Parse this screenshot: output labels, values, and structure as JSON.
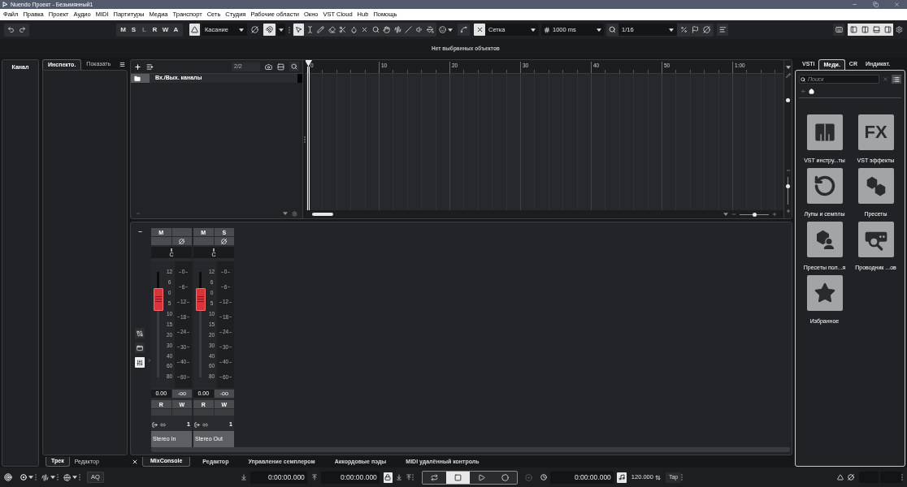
{
  "window": {
    "title": "Nuendo Проект - Безымянный1"
  },
  "menu": [
    "Файл",
    "Правка",
    "Проект",
    "Аудио",
    "MIDI",
    "Партитуры",
    "Медиа",
    "Транспорт",
    "Сеть",
    "Студия",
    "Рабочие области",
    "Окно",
    "VST Cloud",
    "Hub",
    "Помощь"
  ],
  "toolbar": {
    "modes": [
      {
        "label": "M",
        "disabled": false
      },
      {
        "label": "S",
        "disabled": false
      },
      {
        "label": "L",
        "disabled": true
      },
      {
        "label": "R",
        "disabled": false
      },
      {
        "label": "W",
        "disabled": false
      },
      {
        "label": "A",
        "disabled": false
      }
    ],
    "automation_on": true,
    "automation_mode": "Касание",
    "editing_on": true,
    "tools": [
      {
        "kind": "pointer",
        "selected": true
      },
      {
        "kind": "range",
        "selected": false
      },
      {
        "kind": "pencil",
        "selected": false
      },
      {
        "kind": "eraser",
        "selected": false
      },
      {
        "kind": "split",
        "selected": false
      },
      {
        "kind": "glue",
        "selected": false
      },
      {
        "kind": "mute",
        "selected": false
      },
      {
        "kind": "zoom",
        "selected": false
      },
      {
        "kind": "hand",
        "selected": false
      },
      {
        "kind": "comp",
        "selected": false
      },
      {
        "kind": "line",
        "selected": false
      },
      {
        "kind": "play",
        "selected": false
      },
      {
        "kind": "color",
        "selected": false
      }
    ],
    "snap_on": true,
    "snap_type": "Сетка",
    "grid_size": "1000 ms",
    "quantize": "1/16",
    "zone_toggles": [
      {
        "kind": "left",
        "on": true
      },
      {
        "kind": "inspector",
        "on": true
      },
      {
        "kind": "lower",
        "on": true
      },
      {
        "kind": "right",
        "on": true
      }
    ]
  },
  "info_line": "Нет выбранных объектов",
  "left_zone": {
    "channel_panel": "Канал",
    "tabs": [
      {
        "label": "Инспекто.",
        "selected": true
      },
      {
        "label": "Показать",
        "selected": false
      }
    ],
    "bottom_tabs": [
      {
        "label": "Трек",
        "selected": true
      },
      {
        "label": "Редактор",
        "selected": false
      }
    ]
  },
  "project": {
    "track_count": "2/2",
    "tracks": [
      {
        "name": "Вх./Вых. каналы",
        "kind": "folder"
      }
    ],
    "ruler": [
      "0",
      "10",
      "20",
      "30",
      "40",
      "50",
      "1:00"
    ],
    "horizontal_zoom": {
      "level": 0.5
    },
    "vertical_zoom": {
      "level": 0.7
    }
  },
  "mixer": {
    "view_toggles": [
      {
        "kind": "routing",
        "selected": false
      },
      {
        "kind": "window",
        "selected": false
      },
      {
        "kind": "faders",
        "selected": true
      }
    ],
    "channels": [
      {
        "name": "Stereo In",
        "top_buttons": [
          "M"
        ],
        "pan": "C",
        "fader": {
          "level": 0.74
        },
        "fader_scale": [
          "12",
          "6",
          "0",
          "5",
          "10",
          "15",
          "20",
          "30",
          "40",
          "60",
          "80"
        ],
        "meter_scale": [
          "0",
          "6",
          "12",
          "18",
          "24",
          "30",
          "40",
          "60"
        ],
        "volume": "0.00",
        "peak": "-oo",
        "automation": [
          "R",
          "W"
        ],
        "output": "1"
      },
      {
        "name": "Stereo Out",
        "top_buttons": [
          "M",
          "S"
        ],
        "pan": "C",
        "fader": {
          "level": 0.74
        },
        "fader_scale": [
          "12",
          "6",
          "0",
          "5",
          "10",
          "15",
          "20",
          "30",
          "40",
          "60",
          "80"
        ],
        "meter_scale": [
          "0",
          "6",
          "12",
          "18",
          "24",
          "30",
          "40",
          "60"
        ],
        "volume": "0.00",
        "peak": "-oo",
        "automation": [
          "R",
          "W"
        ],
        "output": "1"
      }
    ]
  },
  "lower_zone_tabs": [
    {
      "label": "MixConsole",
      "selected": true
    },
    {
      "label": "Редактор",
      "selected": false
    },
    {
      "label": "Управление семплером",
      "selected": false
    },
    {
      "label": "Аккордовые пэды",
      "selected": false
    },
    {
      "label": "MIDI удалённый контроль",
      "selected": false
    }
  ],
  "right_zone": {
    "tabs": [
      {
        "label": "VSTi",
        "selected": false
      },
      {
        "label": "Меди.",
        "selected": true
      },
      {
        "label": "CR",
        "selected": false
      },
      {
        "label": "Индикат.",
        "selected": false
      }
    ],
    "search": {
      "placeholder": "Поиск"
    },
    "tile_rows": [
      {
        "tiles": [
          {
            "kind": "instruments",
            "label": "VST инстру...ты"
          },
          {
            "kind": "effects",
            "label": "VST эффекты",
            "icon_text": "FX"
          }
        ]
      },
      {
        "tiles": [
          {
            "kind": "loops",
            "label": "Лупы и семплы"
          },
          {
            "kind": "presets",
            "label": "Пресеты"
          }
        ]
      },
      {
        "tiles": [
          {
            "kind": "user_presets",
            "label": "Пресеты пол...я"
          },
          {
            "kind": "browser",
            "label": "Проводник ...ов"
          }
        ]
      },
      {
        "tiles": [
          {
            "kind": "favorites",
            "label": "Избранное"
          }
        ]
      }
    ]
  },
  "transport": {
    "aq": "AQ",
    "left_locator": "0:00:00.000",
    "right_locator": "0:00:00.000",
    "lock_on": true,
    "buttons": [
      {
        "kind": "cycle",
        "active": false
      },
      {
        "kind": "stop",
        "active": true
      },
      {
        "kind": "play",
        "active": false
      },
      {
        "kind": "record",
        "active": false
      }
    ],
    "position": "0:00:00.000",
    "click_on": true,
    "tempo": "120.000",
    "tap": "Tap"
  }
}
